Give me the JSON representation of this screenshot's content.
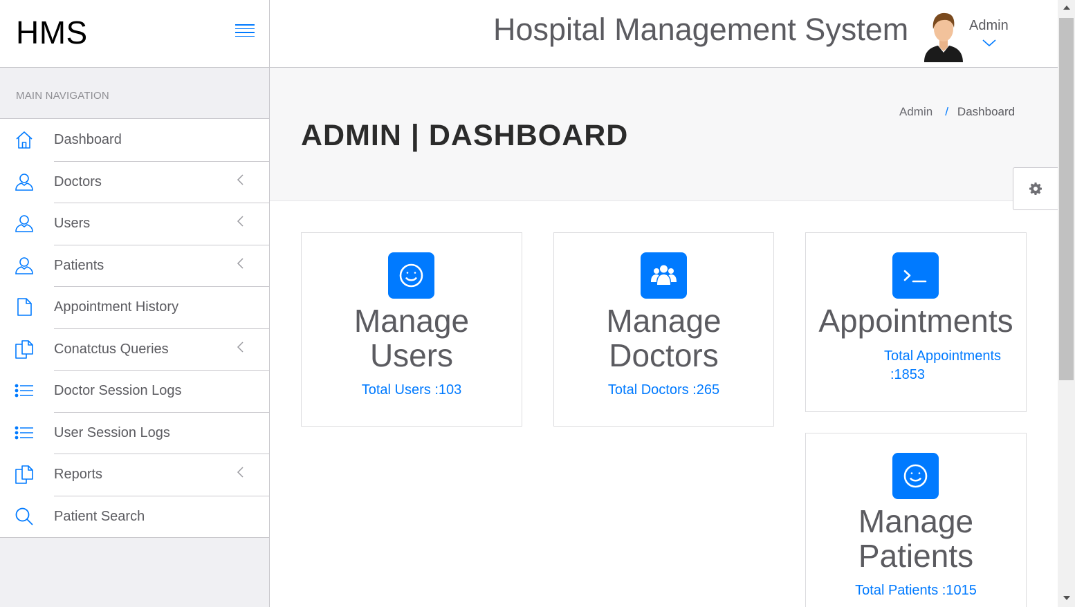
{
  "brand": {
    "name": "HMS"
  },
  "sidebar": {
    "heading": "MAIN NAVIGATION",
    "items": [
      {
        "label": "Dashboard",
        "icon": "home-icon",
        "has_submenu": false
      },
      {
        "label": "Doctors",
        "icon": "user-icon",
        "has_submenu": true
      },
      {
        "label": "Users",
        "icon": "user-icon",
        "has_submenu": true
      },
      {
        "label": "Patients",
        "icon": "user-icon",
        "has_submenu": true
      },
      {
        "label": "Appointment History",
        "icon": "file-icon",
        "has_submenu": false
      },
      {
        "label": "Conatctus Queries",
        "icon": "files-icon",
        "has_submenu": true
      },
      {
        "label": "Doctor Session Logs",
        "icon": "list-icon",
        "has_submenu": false
      },
      {
        "label": "User Session Logs",
        "icon": "list-icon",
        "has_submenu": false
      },
      {
        "label": "Reports",
        "icon": "files-icon",
        "has_submenu": true
      },
      {
        "label": "Patient Search",
        "icon": "search-icon",
        "has_submenu": false
      }
    ]
  },
  "header": {
    "title": "Hospital Management System",
    "user_name": "Admin"
  },
  "page": {
    "title": "ADMIN | DASHBOARD",
    "breadcrumb": {
      "parent": "Admin",
      "separator": "/",
      "current": "Dashboard"
    }
  },
  "cards": [
    {
      "id": "users",
      "icon": "smile-icon",
      "title_line1": "Manage",
      "title_line2": "Users",
      "link": "Total Users :103"
    },
    {
      "id": "doctors",
      "icon": "users-group-icon",
      "title_line1": "Manage",
      "title_line2": "Doctors",
      "link": "Total Doctors :265"
    },
    {
      "id": "appointments",
      "icon": "terminal-icon",
      "title_line1": "Appointments",
      "link_line1": "Total Appointments",
      "link_line2": ":1853"
    },
    {
      "id": "patients",
      "icon": "smile-icon",
      "title_line1": "Manage",
      "title_line2": "Patients",
      "link": "Total Patients :1015"
    }
  ],
  "colors": {
    "accent": "#007aff",
    "text": "#5b5b60",
    "border": "#c8c7cc",
    "sidebar_bg": "#f0f0f3"
  }
}
